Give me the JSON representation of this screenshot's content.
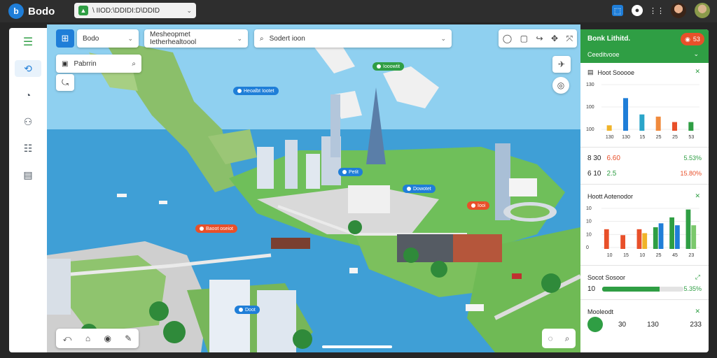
{
  "app": {
    "name": "Bodo",
    "logo_glyph": "b"
  },
  "topbar": {
    "url": "\\ IIOD:\\DDIDI:D\\DDID",
    "right_icons": [
      "share-icon",
      "bell-icon",
      "grid-icon"
    ]
  },
  "rail": {
    "items": [
      "menu-icon",
      "map-pin-icon",
      "clock-icon",
      "drone-icon",
      "list-icon",
      "report-icon"
    ]
  },
  "map_controls": {
    "grid_label": "",
    "dropdown1": "Bodo",
    "dropdown2": "Mesheopmet Ietherhealtoool",
    "search_placeholder": "Sodert ioon",
    "layers_label": "Pabrrin"
  },
  "map_pins": [
    {
      "label": "Iooowtit",
      "color": "#2f9e44"
    },
    {
      "label": "Heoalbt Iootet",
      "color": "#1f7ed8"
    },
    {
      "label": "Baoot oseiot",
      "color": "#e8502a"
    },
    {
      "label": "Dowotet",
      "color": "#1f7ed8"
    },
    {
      "label": "Petit",
      "color": "#1f7ed8"
    },
    {
      "label": "Doot",
      "color": "#1f7ed8"
    },
    {
      "label": "Iooi",
      "color": "#e8502a"
    }
  ],
  "panel": {
    "header_title": "Bonk Lithitd.",
    "header_sub": "Ceeditvooe",
    "header_badge": "53",
    "section1": {
      "title": "Hoot Sooooe",
      "y_ticks": [
        "130",
        "100",
        "100"
      ],
      "x_ticks": [
        "130",
        "130",
        "15",
        "25",
        "25",
        "53"
      ]
    },
    "stats": [
      {
        "left": "8 30",
        "mid": "6.60",
        "pct": "5.53%"
      },
      {
        "left": "6 10",
        "mid": "2.5",
        "pct": "15.80%"
      }
    ],
    "section2": {
      "title": "Hoott Aotenodor",
      "y_ticks": [
        "10",
        "10",
        "10",
        "0"
      ],
      "x_ticks": [
        "10",
        "15",
        "10",
        "25",
        "45",
        "23"
      ]
    },
    "section3": {
      "title": "Socot Sosoor",
      "left": "10",
      "pct": "5.35%",
      "progress": 0.7
    },
    "section4": {
      "title": "Mooleodt",
      "values": [
        "30",
        "130",
        "233"
      ]
    }
  },
  "chart_data": [
    {
      "type": "bar",
      "title": "Hoot Sooooe",
      "categories": [
        "130",
        "130",
        "15",
        "25",
        "25",
        "53"
      ],
      "series": [
        {
          "values": [
            5,
            30,
            15,
            13,
            8,
            8
          ],
          "colors": [
            "#f0b429",
            "#1f7ed8",
            "#2aa5c9",
            "#f08a3c",
            "#e8502a",
            "#2f9e44"
          ]
        }
      ],
      "ylim": [
        0,
        45
      ]
    },
    {
      "type": "bar",
      "title": "Hoott Aotenodor",
      "categories": [
        "10",
        "15",
        "10",
        "25",
        "45",
        "23"
      ],
      "series": [
        {
          "values": [
            10,
            7,
            10,
            11,
            16,
            20
          ],
          "colors": [
            "#e8502a",
            "#e8502a",
            "#e8502a",
            "#2f9e44",
            "#2f9e44",
            "#2f9e44"
          ]
        },
        {
          "values": [
            0,
            0,
            8,
            13,
            12,
            12
          ],
          "colors": [
            "#f0b429",
            "#f0b429",
            "#f0b429",
            "#1f7ed8",
            "#1f7ed8",
            "#7bc86c"
          ]
        }
      ],
      "ylim": [
        0,
        22
      ]
    }
  ]
}
